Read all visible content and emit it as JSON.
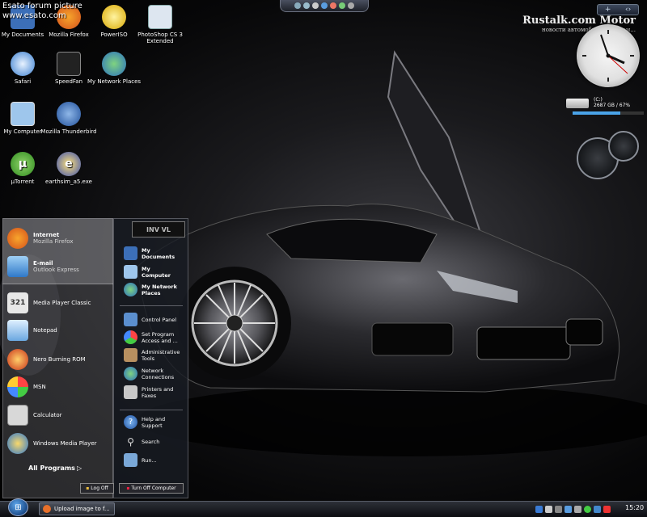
{
  "watermark": {
    "line1": "Esato forum picture",
    "line2": "www.esato.com"
  },
  "desktop_icons": [
    {
      "label": "My Documents",
      "icon": "my-documents-icon"
    },
    {
      "label": "Mozilla Firefox",
      "icon": "firefox-icon"
    },
    {
      "label": "PowerISO",
      "icon": "poweriso-icon"
    },
    {
      "label": "PhotoShop CS 3 Extended",
      "icon": "photoshop-icon"
    },
    {
      "label": "Safari",
      "icon": "safari-icon"
    },
    {
      "label": "SpeedFan",
      "icon": "speedfan-icon"
    },
    {
      "label": "My Network Places",
      "icon": "network-places-icon"
    },
    {
      "label": "My Computer",
      "icon": "my-computer-icon"
    },
    {
      "label": "Mozilla Thunderbird",
      "icon": "thunderbird-icon"
    },
    {
      "label": "µTorrent",
      "icon": "utorrent-icon"
    },
    {
      "label": "earthsim_a5.exe",
      "icon": "earthsim-icon"
    }
  ],
  "sidebar": {
    "rustalk_title": "Rustalk.com Motor",
    "rustalk_sub": "новости автомобильной пром...",
    "drive_label": "(C:)",
    "drive_info": "2687 GB / 67%",
    "drive_fill": 0.67
  },
  "start_menu": {
    "brand": "INV VL",
    "pinned": [
      {
        "title": "Internet",
        "sub": "Mozilla Firefox"
      },
      {
        "title": "E-mail",
        "sub": "Outlook Express"
      }
    ],
    "programs": [
      "Media Player Classic",
      "Notepad",
      "Nero Burning ROM",
      "MSN",
      "Calculator",
      "Windows Media Player"
    ],
    "all_programs": "All Programs",
    "right_items": [
      "My Documents",
      "My Computer",
      "My Network Places",
      "Control Panel",
      "Set Program Access and ...",
      "Administrative Tools",
      "Network Connections",
      "Printers and Faxes",
      "Help and Support",
      "Search",
      "Run..."
    ],
    "log_off": "Log Off",
    "turn_off": "Turn Off Computer"
  },
  "taskbar": {
    "task_label": "Upload image to f...",
    "clock": "15:20"
  }
}
